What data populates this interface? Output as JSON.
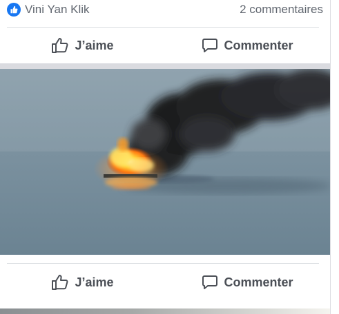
{
  "post": {
    "reactions": {
      "liker_name": "Vini Yan Klik",
      "comments_count": "2 commentaires"
    },
    "actions": {
      "like_label": "J’aime",
      "comment_label": "Commenter"
    },
    "image": {
      "alt": "Bateau en feu en mer avec fumée noire"
    }
  },
  "second_post": {
    "actions": {
      "like_label": "J’aime",
      "comment_label": "Commenter"
    }
  },
  "colors": {
    "like_badge": "#1877f2",
    "text_secondary": "#616770",
    "action_text": "#4b4f56",
    "divider": "#dadde1",
    "feed_gap": "#dadbe0"
  }
}
